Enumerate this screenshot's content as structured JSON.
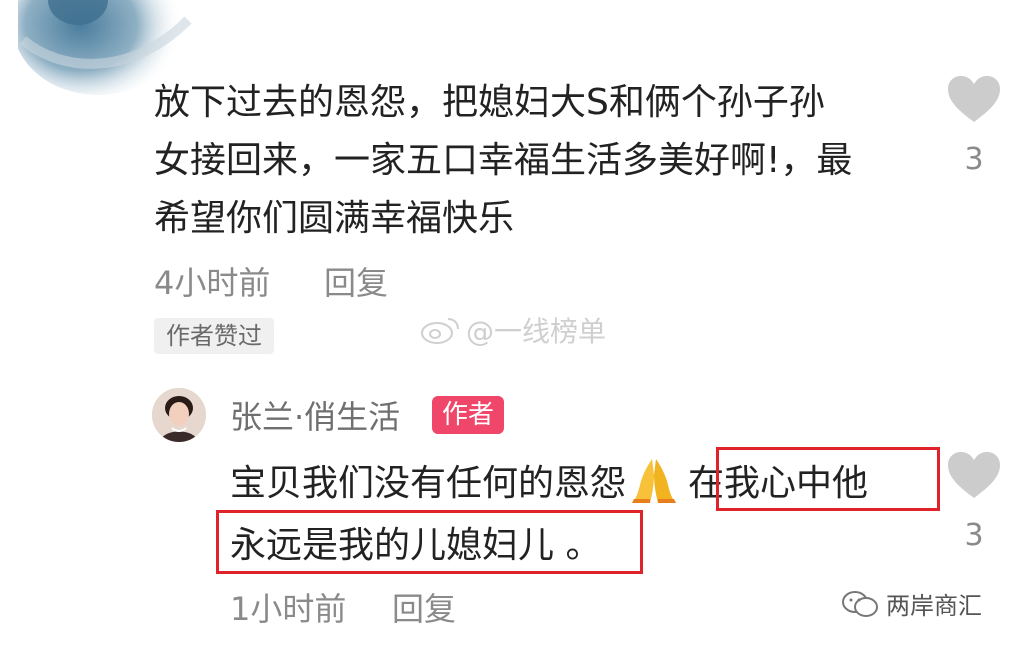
{
  "comment": {
    "text": "放下过去的恩怨，把媳妇大S和俩个孙子孙\n女接回来，一家五口幸福生活多美好啊!，最\n希望你们圆满幸福快乐",
    "time": "4小时前",
    "reply_label": "回复",
    "like_count": "3",
    "author_liked": "作者赞过"
  },
  "watermark": {
    "text": "@一线榜单"
  },
  "reply": {
    "name": "张兰·俏生活",
    "badge": "作者",
    "text_part1": "宝贝我们没有任何的恩怨",
    "text_part2": "在我心中他",
    "text_line2": "永远是我的儿媳妇儿 。",
    "time": "1小时前",
    "reply_label": "回复",
    "like_count": "3"
  },
  "footer_watermark": {
    "text": "两岸商汇"
  },
  "colors": {
    "badge": "#f0466a",
    "highlight_box": "#e0222a",
    "meta": "#8a8a8a"
  }
}
